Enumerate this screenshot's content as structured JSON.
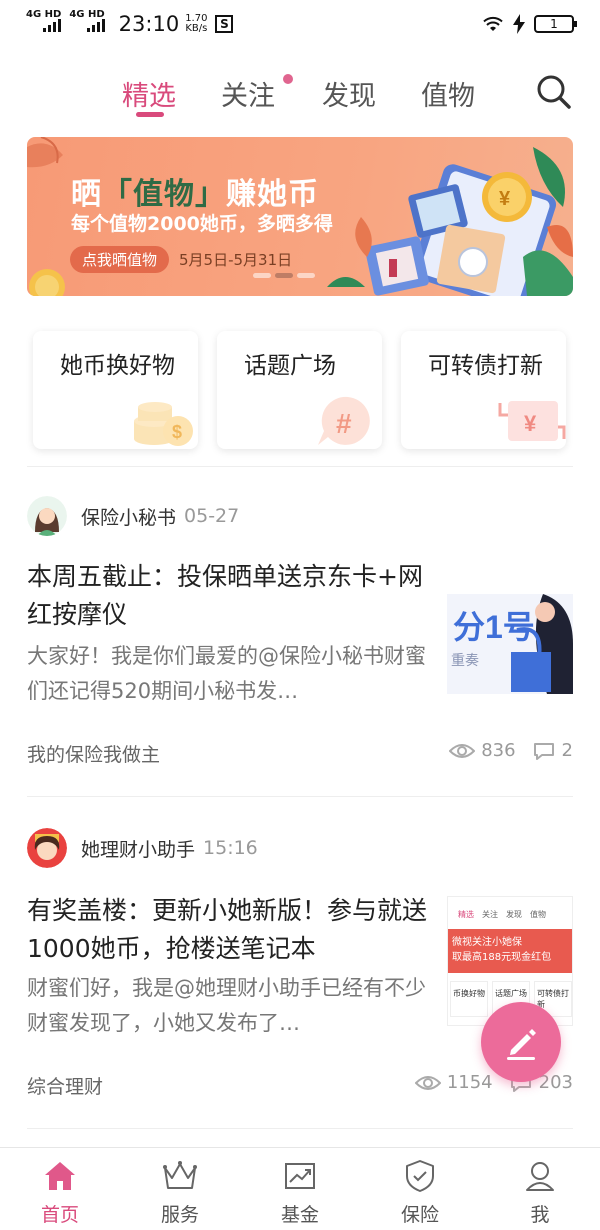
{
  "status_bar": {
    "net1": "4G HD",
    "net2": "4G HD",
    "time": "23:10",
    "speed_value": "1.70",
    "speed_unit": "KB/s",
    "s_icon": "S",
    "battery": "1"
  },
  "top_tabs": [
    {
      "label": "精选",
      "active": true
    },
    {
      "label": "关注",
      "badge_dot": true
    },
    {
      "label": "发现"
    },
    {
      "label": "值物"
    }
  ],
  "banner": {
    "title_a": "晒",
    "title_hl": "「值物」",
    "title_b": "赚她币",
    "subtitle": "每个值物2000她币，多晒多得",
    "button": "点我晒值物",
    "date": "5月5日-5月31日",
    "page_index": 2,
    "page_total": 3
  },
  "quick_entries": [
    {
      "label": "她币换好物",
      "icon": "coins-icon"
    },
    {
      "label": "话题广场",
      "icon": "hashtag-icon"
    },
    {
      "label": "可转债打新",
      "icon": "yuan-icon"
    }
  ],
  "posts": [
    {
      "author": "保险小秘书",
      "time": "05-27",
      "title": "本周五截止：投保晒单送京东卡+网红按摩仪",
      "summary": "大家好！我是你们最爱的@保险小秘书财蜜们还记得520期间小秘书发…",
      "category": "我的保险我做主",
      "views": "836",
      "comments": "2",
      "thumb_text": "分1号",
      "thumb_sub": "重奏"
    },
    {
      "author": "她理财小助手",
      "time": "15:16",
      "title": "有奖盖楼：更新小她新版！参与就送1000她币，抢楼送笔记本",
      "summary": "财蜜们好，我是@她理财小助手已经有不少财蜜发现了，小她又发布了…",
      "category": "综合理财",
      "views": "1154",
      "comments": "203",
      "thumb_tabs": [
        "精选",
        "关注",
        "发现",
        "值物"
      ],
      "thumb_banner": "微视关注小她保",
      "thumb_banner2": "取最高188元现金红包",
      "thumb_cards": [
        "币换好物",
        "话题广场",
        "可转债打新"
      ]
    }
  ],
  "bottom_nav": [
    {
      "label": "首页",
      "icon": "home-icon",
      "active": true
    },
    {
      "label": "服务",
      "icon": "crown-icon"
    },
    {
      "label": "基金",
      "icon": "chart-icon"
    },
    {
      "label": "保险",
      "icon": "shield-icon"
    },
    {
      "label": "我",
      "icon": "profile-icon"
    }
  ],
  "colors": {
    "accent": "#d94a7c",
    "banner_bg": "#f79a76",
    "fab": "#ec6b9a"
  }
}
